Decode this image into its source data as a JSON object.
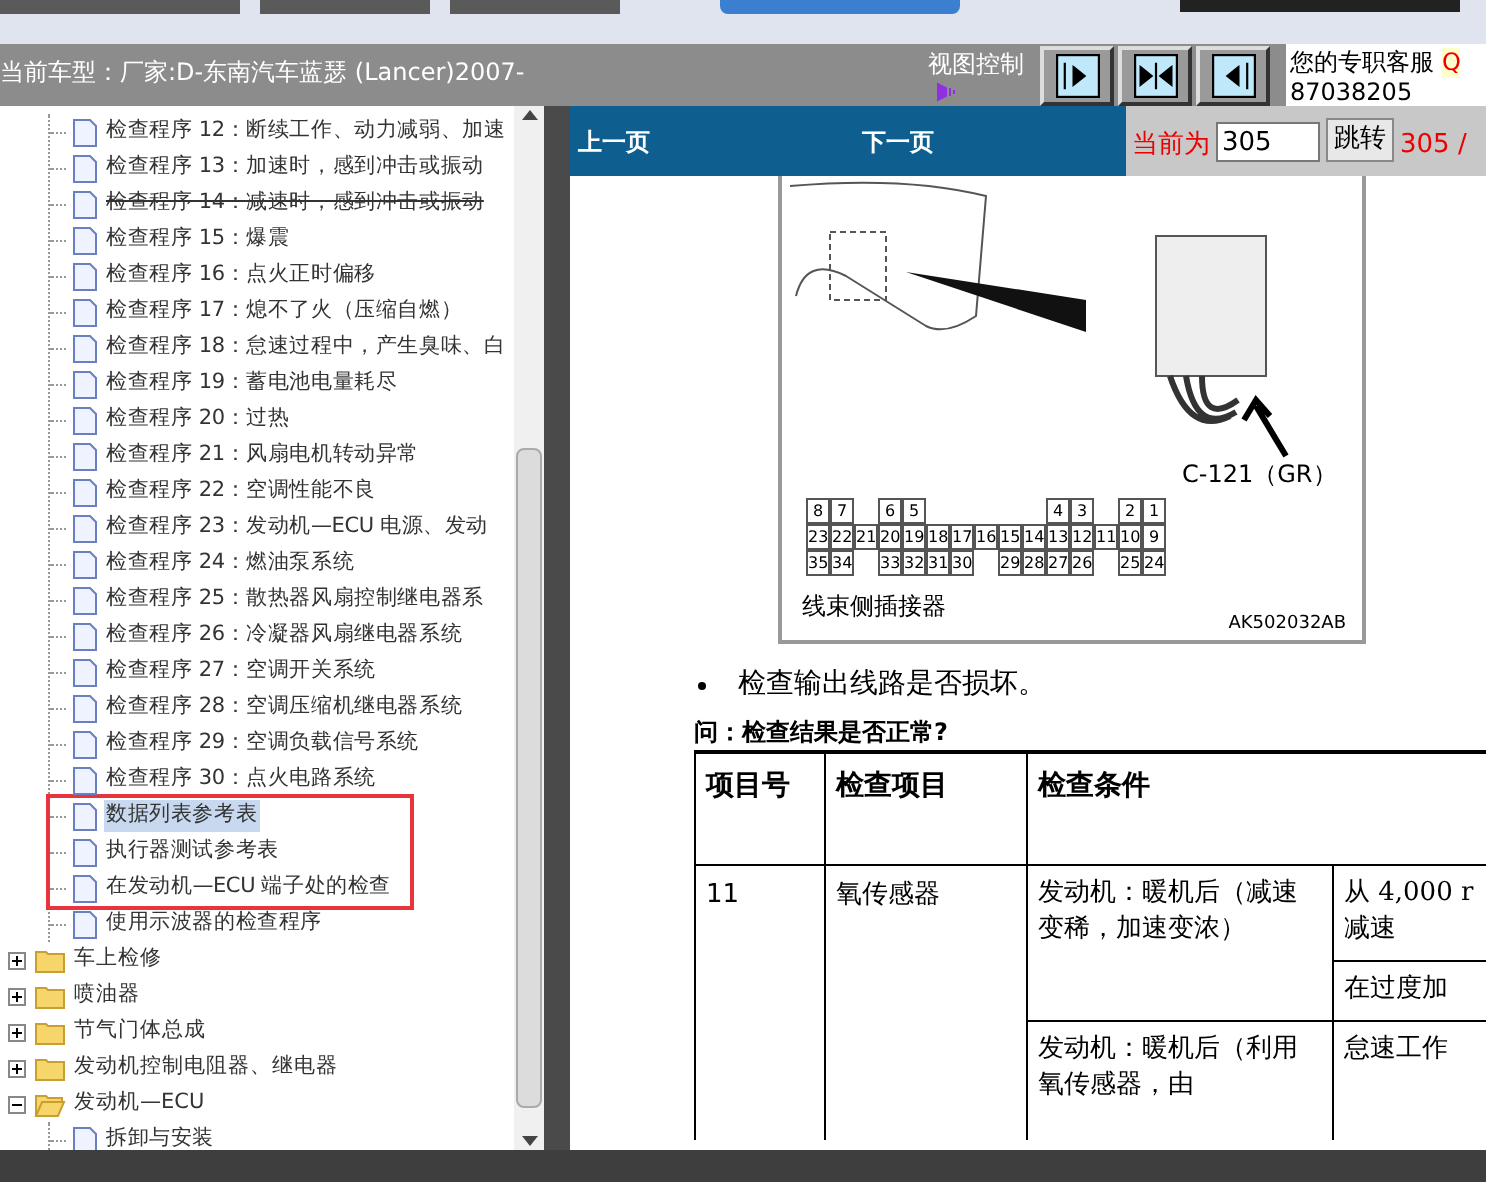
{
  "header": {
    "car_model": "当前车型：厂家:D-东南汽车蓝瑟 (Lancer)2007-",
    "view_control_label": "视图控制",
    "view_buttons": [
      {
        "kind": "right"
      },
      {
        "kind": "both"
      },
      {
        "kind": "left"
      }
    ],
    "service_label": "您的专职客服",
    "service_link": "Q",
    "service_number": "87038205"
  },
  "tree": {
    "continued_children": [
      {
        "label": "检查程序 12：断续工作、动力减弱、加速",
        "selected": false,
        "struck": false
      },
      {
        "label": "检查程序 13：加速时，感到冲击或振动",
        "selected": false,
        "struck": false
      },
      {
        "label": "检查程序 14：减速时，感到冲击或振动",
        "selected": false,
        "struck": true
      },
      {
        "label": "检查程序 15：爆震",
        "selected": false,
        "struck": false
      },
      {
        "label": "检查程序 16：点火正时偏移",
        "selected": false,
        "struck": false
      },
      {
        "label": "检查程序 17：熄不了火（压缩自燃）",
        "selected": false,
        "struck": false
      },
      {
        "label": "检查程序 18：怠速过程中，产生臭味、白",
        "selected": false,
        "struck": false
      },
      {
        "label": "检查程序 19：蓄电池电量耗尽",
        "selected": false,
        "struck": false
      },
      {
        "label": "检查程序 20：过热",
        "selected": false,
        "struck": false
      },
      {
        "label": "检查程序 21：风扇电机转动异常",
        "selected": false,
        "struck": false
      },
      {
        "label": "检查程序 22：空调性能不良",
        "selected": false,
        "struck": false
      },
      {
        "label": "检查程序 23：发动机—ECU 电源、发动",
        "selected": false,
        "struck": false
      },
      {
        "label": "检查程序 24：燃油泵系统",
        "selected": false,
        "struck": false
      },
      {
        "label": "检查程序 25：散热器风扇控制继电器系",
        "selected": false,
        "struck": false
      },
      {
        "label": "检查程序 26：冷凝器风扇继电器系统",
        "selected": false,
        "struck": false
      },
      {
        "label": "检查程序 27：空调开关系统",
        "selected": false,
        "struck": false
      },
      {
        "label": "检查程序 28：空调压缩机继电器系统",
        "selected": false,
        "struck": false
      },
      {
        "label": "检查程序 29：空调负载信号系统",
        "selected": false,
        "struck": false
      },
      {
        "label": "检查程序 30：点火电路系统",
        "selected": false,
        "struck": false
      },
      {
        "label": "数据列表参考表",
        "selected": true,
        "struck": false,
        "framed": true
      },
      {
        "label": "执行器测试参考表",
        "selected": false,
        "struck": false,
        "framed": true
      },
      {
        "label": "在发动机—ECU 端子处的检查",
        "selected": false,
        "struck": false,
        "framed": true
      },
      {
        "label": "使用示波器的检查程序",
        "selected": false,
        "struck": false
      }
    ],
    "folders": [
      {
        "label": "车上检修",
        "expanded": false
      },
      {
        "label": "喷油器",
        "expanded": false
      },
      {
        "label": "节气门体总成",
        "expanded": false
      },
      {
        "label": "发动机控制电阻器、继电器",
        "expanded": false
      },
      {
        "label": "发动机—ECU",
        "expanded": true,
        "children": [
          {
            "label": "拆卸与安装",
            "selected": false,
            "struck": false
          }
        ]
      }
    ]
  },
  "nav": {
    "prev": "上一页",
    "next": "下一页",
    "current_label": "当前为",
    "page_input": "305",
    "go_button": "跳转",
    "page_total": "305 /"
  },
  "document": {
    "figure": {
      "connector_label": "C-121（GR）",
      "pin_rows": [
        [
          "8",
          "7",
          null,
          "6",
          "5",
          null,
          null,
          null,
          null,
          null,
          "4",
          "3",
          null,
          "2",
          "1"
        ],
        [
          "23",
          "22",
          "21",
          "20",
          "19",
          "18",
          "17",
          "16",
          "15",
          "14",
          "13",
          "12",
          "11",
          "10",
          "9"
        ],
        [
          "35",
          "34",
          null,
          "33",
          "32",
          "31",
          "30",
          null,
          "29",
          "28",
          "27",
          "26",
          null,
          "25",
          "24"
        ]
      ],
      "caption": "线束侧插接器",
      "code": "AK502032AB"
    },
    "bullet": "检查输出线路是否损坏。",
    "question": "问：检查结果是否正常?",
    "table": {
      "columns": [
        "项目号",
        "检查项目",
        "检查条件"
      ],
      "item_no": "11",
      "item": "氧传感器",
      "conditions": [
        {
          "text": "发动机：暖机后（减速变稀，加速变浓）",
          "states": [
            "从 4,000 r\n减速",
            "在过度加"
          ]
        },
        {
          "text": "发动机：暖机后（利用氧传感器，由",
          "states": [
            "怠速工作"
          ]
        }
      ]
    }
  }
}
